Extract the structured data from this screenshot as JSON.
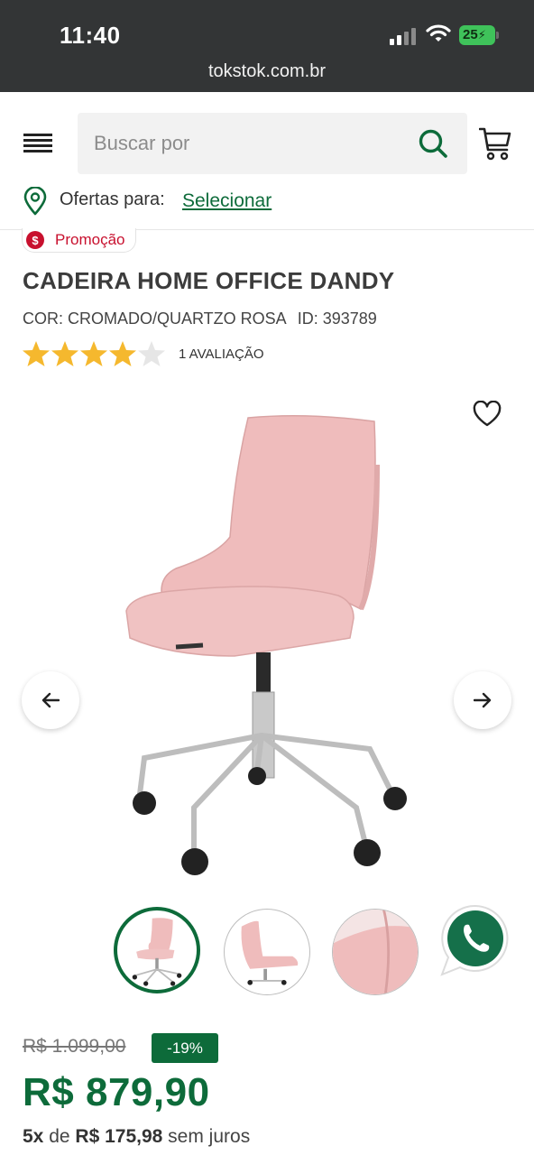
{
  "status_bar": {
    "time": "11:40",
    "battery": "25"
  },
  "browser": {
    "url": "tokstok.com.br"
  },
  "header": {
    "search_placeholder": "Buscar por",
    "offers_label": "Ofertas para:",
    "offers_link": "Selecionar"
  },
  "product": {
    "promo_badge": "Promoção",
    "promo_icon_text": "$",
    "title": "CADEIRA HOME OFFICE DANDY",
    "color": "COR: CROMADO/QUARTZO ROSA",
    "id": "ID: 393789",
    "rating": 4,
    "rating_max": 5,
    "reviews": "1 AVALIAÇÃO",
    "old_price": "R$ 1.099,00",
    "discount": "-19%",
    "price": "R$ 879,90",
    "installments_count": "5x",
    "installments_de": "de",
    "installments_value": "R$ 175,98",
    "installments_suffix": "sem juros"
  },
  "colors": {
    "brand_green": "#0d6b3a",
    "promo_red": "#c8102e",
    "star_gold": "#f5b82e",
    "chair_pink": "#efbcbc"
  },
  "icons": [
    "menu-icon",
    "search-icon",
    "cart-icon",
    "location-pin-icon",
    "heart-icon",
    "arrow-left-icon",
    "arrow-right-icon",
    "whatsapp-icon"
  ]
}
